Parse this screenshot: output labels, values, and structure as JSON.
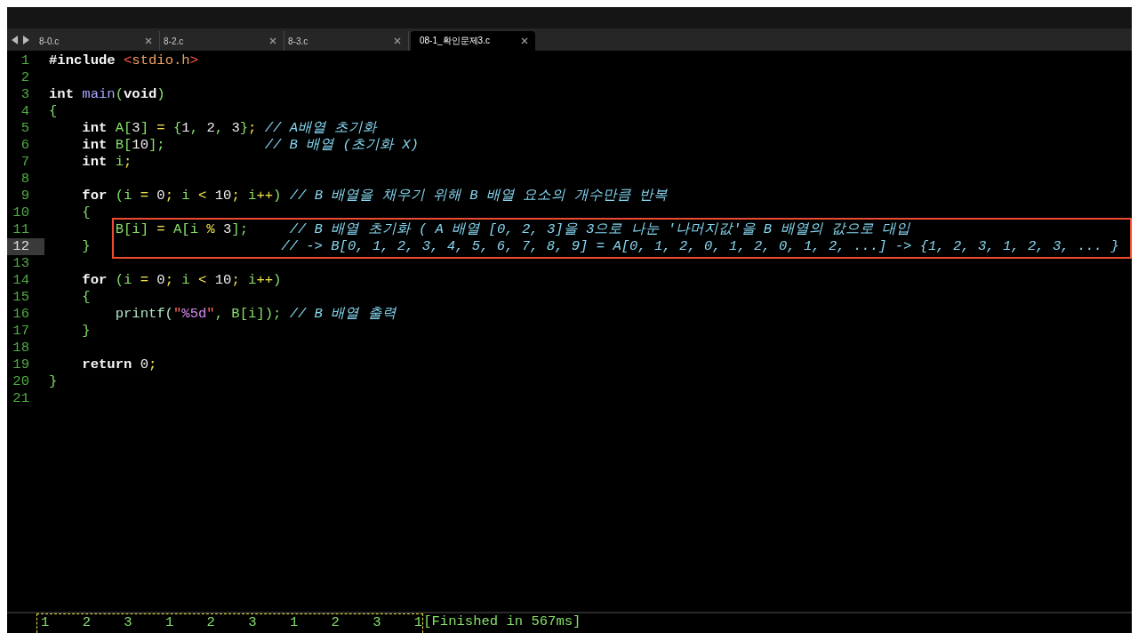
{
  "tabs": [
    {
      "label": "8-0.c",
      "selected": false
    },
    {
      "label": "8-2.c",
      "selected": false
    },
    {
      "label": "8-3.c",
      "selected": false
    },
    {
      "label": "08-1_확인문제3.c",
      "selected": true
    }
  ],
  "editor": {
    "lines": [
      {
        "number": "1",
        "current": false,
        "boxed": false,
        "tokens": [
          {
            "kind": "kw",
            "t": "#include "
          },
          {
            "kind": "incb",
            "t": "<"
          },
          {
            "kind": "inc",
            "t": "stdio.h"
          },
          {
            "kind": "incb",
            "t": ">"
          }
        ]
      },
      {
        "number": "2",
        "current": false,
        "boxed": false
      },
      {
        "number": "3",
        "current": false,
        "boxed": false,
        "tokens": [
          {
            "kind": "kw",
            "t": "int "
          },
          {
            "kind": "fn",
            "t": "main"
          },
          {
            "kind": "punc",
            "t": "("
          },
          {
            "kind": "kw",
            "t": "void"
          },
          {
            "kind": "punc",
            "t": ")"
          }
        ]
      },
      {
        "number": "4",
        "current": false,
        "boxed": false,
        "tokens": [
          {
            "kind": "punc",
            "t": "{"
          }
        ]
      },
      {
        "number": "5",
        "current": false,
        "boxed": false,
        "tokens": [
          {
            "kind": "kw",
            "t": "    int "
          },
          {
            "kind": "id",
            "t": "A["
          },
          {
            "kind": "num",
            "t": "3"
          },
          {
            "kind": "id",
            "t": "] "
          },
          {
            "kind": "op",
            "t": "="
          },
          {
            "kind": "punc",
            "t": " {"
          },
          {
            "kind": "num",
            "t": "1"
          },
          {
            "kind": "punc",
            "t": ", "
          },
          {
            "kind": "num",
            "t": "2"
          },
          {
            "kind": "punc",
            "t": ", "
          },
          {
            "kind": "num",
            "t": "3"
          },
          {
            "kind": "punc",
            "t": "}"
          },
          {
            "kind": "op",
            "t": ";"
          },
          {
            "kind": "cm",
            "t": " // A배열 초기화"
          }
        ]
      },
      {
        "number": "6",
        "current": false,
        "boxed": false,
        "tokens": [
          {
            "kind": "kw",
            "t": "    int "
          },
          {
            "kind": "id",
            "t": "B["
          },
          {
            "kind": "num",
            "t": "10"
          },
          {
            "kind": "id",
            "t": "];"
          },
          {
            "kind": "cm",
            "t": "            // B 배열 (초기화 X)"
          }
        ]
      },
      {
        "number": "7",
        "current": false,
        "boxed": false,
        "tokens": [
          {
            "kind": "kw",
            "t": "    int "
          },
          {
            "kind": "id",
            "t": "i"
          },
          {
            "kind": "op",
            "t": ";"
          }
        ]
      },
      {
        "number": "8",
        "current": false,
        "boxed": false
      },
      {
        "number": "9",
        "current": false,
        "boxed": false,
        "tokens": [
          {
            "kind": "kw",
            "t": "    for "
          },
          {
            "kind": "punc",
            "t": "("
          },
          {
            "kind": "id",
            "t": "i "
          },
          {
            "kind": "op",
            "t": "="
          },
          {
            "kind": "num",
            "t": " 0"
          },
          {
            "kind": "op",
            "t": ";"
          },
          {
            "kind": "id",
            "t": " i "
          },
          {
            "kind": "op",
            "t": "<"
          },
          {
            "kind": "num",
            "t": " 10"
          },
          {
            "kind": "op",
            "t": ";"
          },
          {
            "kind": "id",
            "t": " i"
          },
          {
            "kind": "op",
            "t": "++"
          },
          {
            "kind": "punc",
            "t": ")"
          },
          {
            "kind": "cm",
            "t": " // B 배열을 채우기 위해 B 배열 요소의 개수만큼 반복"
          }
        ]
      },
      {
        "number": "10",
        "current": false,
        "boxed": false,
        "tokens": [
          {
            "kind": "punc",
            "t": "    {"
          }
        ]
      },
      {
        "number": "11",
        "current": false,
        "boxed": true,
        "tokens": [
          {
            "kind": "id",
            "t": "        B[i] "
          },
          {
            "kind": "op",
            "t": "="
          },
          {
            "kind": "id",
            "t": " A[i "
          },
          {
            "kind": "op",
            "t": "%"
          },
          {
            "kind": "num",
            "t": " 3"
          },
          {
            "kind": "id",
            "t": "];"
          },
          {
            "kind": "cm",
            "t": "     // B 배열 초기화 ( A 배열 [0, 2, 3]을 3으로 나눈 '나머지값'을 B 배열의 값으로 대입"
          }
        ]
      },
      {
        "number": "12",
        "current": true,
        "boxed": true,
        "tokens": [
          {
            "kind": "punc",
            "t": "    }"
          },
          {
            "kind": "cm",
            "t": "                       // -> B[0, 1, 2, 3, 4, 5, 6, 7, 8, 9] = A[0, 1, 2, 0, 1, 2, 0, 1, 2, ...] -> {1, 2, 3, 1, 2, 3, ... }"
          }
        ]
      },
      {
        "number": "13",
        "current": false,
        "boxed": false
      },
      {
        "number": "14",
        "current": false,
        "boxed": false,
        "tokens": [
          {
            "kind": "kw",
            "t": "    for "
          },
          {
            "kind": "punc",
            "t": "("
          },
          {
            "kind": "id",
            "t": "i "
          },
          {
            "kind": "op",
            "t": "="
          },
          {
            "kind": "num",
            "t": " 0"
          },
          {
            "kind": "op",
            "t": ";"
          },
          {
            "kind": "id",
            "t": " i "
          },
          {
            "kind": "op",
            "t": "<"
          },
          {
            "kind": "num",
            "t": " 10"
          },
          {
            "kind": "op",
            "t": ";"
          },
          {
            "kind": "id",
            "t": " i"
          },
          {
            "kind": "op",
            "t": "++"
          },
          {
            "kind": "punc",
            "t": ")"
          }
        ]
      },
      {
        "number": "15",
        "current": false,
        "boxed": false,
        "tokens": [
          {
            "kind": "punc",
            "t": "    {"
          }
        ]
      },
      {
        "number": "16",
        "current": false,
        "boxed": false,
        "tokens": [
          {
            "kind": "fncall",
            "t": "        printf("
          },
          {
            "kind": "strq",
            "t": "\""
          },
          {
            "kind": "str",
            "t": "%5d"
          },
          {
            "kind": "strq",
            "t": "\""
          },
          {
            "kind": "punc",
            "t": ", "
          },
          {
            "kind": "id",
            "t": "B[i]);"
          },
          {
            "kind": "cm",
            "t": " // B 배열 출력"
          }
        ]
      },
      {
        "number": "17",
        "current": false,
        "boxed": false,
        "tokens": [
          {
            "kind": "punc",
            "t": "    }"
          }
        ]
      },
      {
        "number": "18",
        "current": false,
        "boxed": false
      },
      {
        "number": "19",
        "current": false,
        "boxed": false,
        "tokens": [
          {
            "kind": "kw",
            "t": "    return "
          },
          {
            "kind": "num",
            "t": "0"
          },
          {
            "kind": "op",
            "t": ";"
          }
        ]
      },
      {
        "number": "20",
        "current": false,
        "boxed": false,
        "tokens": [
          {
            "kind": "punc",
            "t": "}"
          }
        ]
      },
      {
        "number": "21",
        "current": false,
        "boxed": false
      }
    ]
  },
  "output": [
    {
      "text": "1    2    3    1    2    3    1    2    3    1",
      "selected": true
    },
    {
      "text": "[Finished in 567ms]",
      "selected": false
    }
  ]
}
